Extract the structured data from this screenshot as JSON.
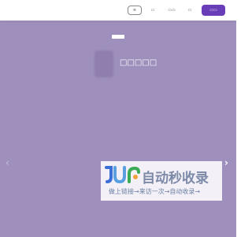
{
  "navbar": {
    "buttons": [
      {
        "label": "≡",
        "style": "outlined"
      },
      {
        "label": "▭",
        "style": "link"
      },
      {
        "label": "▭▭",
        "style": "link"
      },
      {
        "label": "▭",
        "style": "link"
      },
      {
        "label": "▭▭",
        "style": "primary"
      }
    ]
  },
  "hero": {
    "tag": "",
    "title": "□□□□□",
    "prev_arrow": "‹",
    "next_arrow": "›"
  },
  "watermark": {
    "title": "自动秒收录",
    "subtitle": "做上链接→来访一次→自动收录→"
  },
  "colors": {
    "hero_bg": "#9e8fbd",
    "primary": "#6a3db8",
    "watermark_text": "#7c8aa8"
  }
}
